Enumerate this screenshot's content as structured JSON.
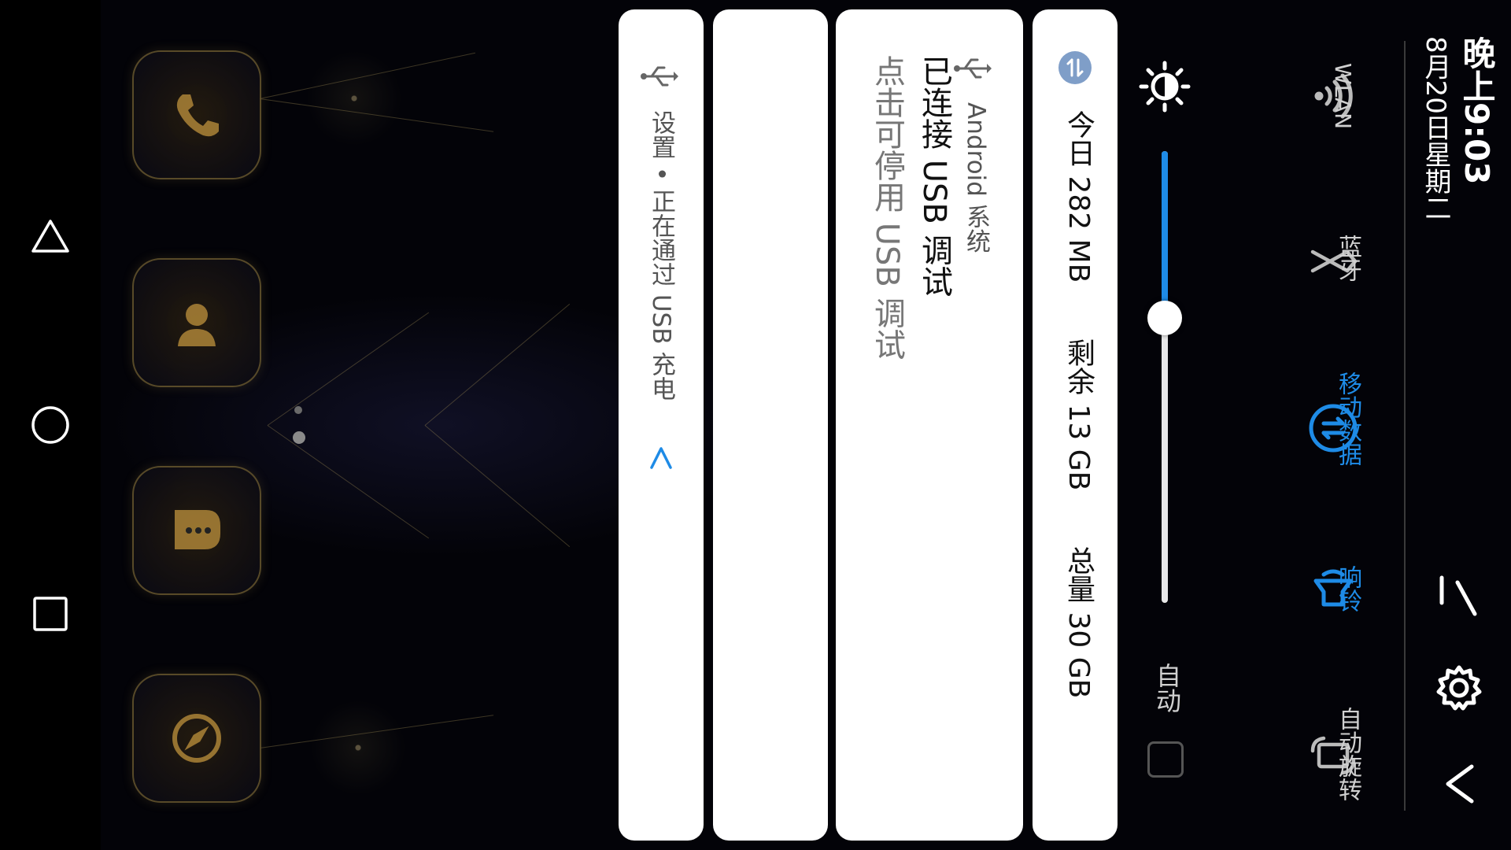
{
  "status": {
    "time": "晚上9:03",
    "date": "8月20日星期二"
  },
  "quick_settings": {
    "tiles": [
      {
        "label": "WLAN",
        "icon": "wifi-icon",
        "active": false
      },
      {
        "label": "蓝牙",
        "icon": "bluetooth-icon",
        "active": false
      },
      {
        "label": "移动数据",
        "icon": "mobile-data-icon",
        "active": true
      },
      {
        "label": "响铃",
        "icon": "ring-bell-icon",
        "active": true
      },
      {
        "label": "自动旋转",
        "icon": "auto-rotate-icon",
        "active": false
      }
    ],
    "brightness": {
      "level": 0.37,
      "auto_label": "自动",
      "auto_checked": false
    },
    "header_icons": [
      "edit-icon",
      "settings-gear-icon",
      "collapse-chevron-icon"
    ]
  },
  "data_usage": {
    "today": "今日 282 MB",
    "remaining": "剩余 13 GB",
    "total": "总量 30 GB"
  },
  "notifications": [
    {
      "app": "Android 系统",
      "title": "已连接 USB 调试",
      "body": "点击可停用 USB 调试"
    },
    {
      "app": "设置 • 正在通过 USB 充电"
    }
  ],
  "colors": {
    "accent": "#1e8be6",
    "card": "#ffffff",
    "shade_bg": "#000000"
  }
}
